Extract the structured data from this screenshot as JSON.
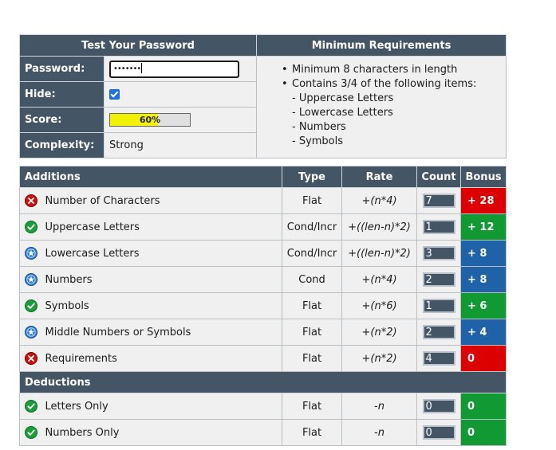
{
  "test": {
    "heading": "Test Your Password",
    "password_label": "Password:",
    "password_value": "•••••••",
    "hide_label": "Hide:",
    "hide_checked": true,
    "score_label": "Score:",
    "score_text": "60%",
    "score_fraction": 0.6,
    "complexity_label": "Complexity:",
    "complexity_value": "Strong"
  },
  "requirements": {
    "heading": "Minimum Requirements",
    "items": [
      "Minimum 8 characters in length",
      "Contains 3/4 of the following items:",
      "- Uppercase Letters",
      "- Lowercase Letters",
      "- Numbers",
      "- Symbols"
    ]
  },
  "additions": {
    "headers": [
      "Additions",
      "Type",
      "Rate",
      "Count",
      "Bonus"
    ],
    "rows": [
      {
        "status": "fail",
        "name": "Number of Characters",
        "type": "Flat",
        "rate": "+(n*4)",
        "count": "7",
        "bonus": "+ 28",
        "bonus_color": "#dd0000"
      },
      {
        "status": "pass",
        "name": "Uppercase Letters",
        "type": "Cond/Incr",
        "rate": "+((len-n)*2)",
        "count": "1",
        "bonus": "+ 12",
        "bonus_color": "#119933"
      },
      {
        "status": "exceed",
        "name": "Lowercase Letters",
        "type": "Cond/Incr",
        "rate": "+((len-n)*2)",
        "count": "3",
        "bonus": "+ 8",
        "bonus_color": "#1f62a8"
      },
      {
        "status": "exceed",
        "name": "Numbers",
        "type": "Cond",
        "rate": "+(n*4)",
        "count": "2",
        "bonus": "+ 8",
        "bonus_color": "#1f62a8"
      },
      {
        "status": "pass",
        "name": "Symbols",
        "type": "Flat",
        "rate": "+(n*6)",
        "count": "1",
        "bonus": "+ 6",
        "bonus_color": "#119933"
      },
      {
        "status": "exceed",
        "name": "Middle Numbers or Symbols",
        "type": "Flat",
        "rate": "+(n*2)",
        "count": "2",
        "bonus": "+ 4",
        "bonus_color": "#1f62a8"
      },
      {
        "status": "fail",
        "name": "Requirements",
        "type": "Flat",
        "rate": "+(n*2)",
        "count": "4",
        "bonus": "0",
        "bonus_color": "#dd0000"
      }
    ]
  },
  "deductions": {
    "heading": "Deductions",
    "rows": [
      {
        "status": "pass",
        "name": "Letters Only",
        "type": "Flat",
        "rate": "-n",
        "count": "0",
        "bonus": "0",
        "bonus_color": "#119933"
      },
      {
        "status": "pass",
        "name": "Numbers Only",
        "type": "Flat",
        "rate": "-n",
        "count": "0",
        "bonus": "0",
        "bonus_color": "#119933"
      }
    ]
  },
  "status_colors": {
    "pass": "#1a9e3a",
    "fail": "#cc1111",
    "exceed": "#2f7fd6"
  },
  "status_icons": {
    "pass": "check-circle-icon",
    "fail": "x-circle-icon",
    "exceed": "star-circle-icon"
  }
}
